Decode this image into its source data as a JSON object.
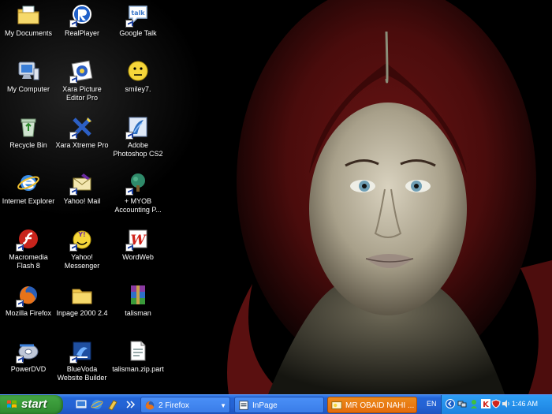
{
  "desktop": {
    "icons": [
      {
        "label": "My Documents",
        "icon": "folder-docs-icon"
      },
      {
        "label": "RealPlayer",
        "icon": "realplayer-icon"
      },
      {
        "label": "Google Talk",
        "icon": "google-talk-icon"
      },
      {
        "label": "My Computer",
        "icon": "computer-icon"
      },
      {
        "label": "Xara Picture Editor Pro",
        "icon": "xara-picture-icon"
      },
      {
        "label": "smiley7.",
        "icon": "smiley-icon"
      },
      {
        "label": "Recycle Bin",
        "icon": "recycle-bin-icon"
      },
      {
        "label": "Xara Xtreme Pro",
        "icon": "xara-xtreme-icon"
      },
      {
        "label": "Adobe Photoshop CS2",
        "icon": "photoshop-icon"
      },
      {
        "label": "Internet Explorer",
        "icon": "internet-explorer-icon"
      },
      {
        "label": "Yahoo! Mail",
        "icon": "yahoo-mail-icon"
      },
      {
        "label": "+ MYOB Accounting P...",
        "icon": "myob-icon"
      },
      {
        "label": "Macromedia Flash 8",
        "icon": "flash-icon"
      },
      {
        "label": "Yahoo! Messenger",
        "icon": "yahoo-messenger-icon"
      },
      {
        "label": "WordWeb",
        "icon": "wordweb-icon"
      },
      {
        "label": "Mozilla Firefox",
        "icon": "firefox-icon"
      },
      {
        "label": "Inpage 2000 2.4",
        "icon": "folder-icon"
      },
      {
        "label": "talisman",
        "icon": "winrar-icon"
      },
      {
        "label": "PowerDVD",
        "icon": "powerdvd-icon"
      },
      {
        "label": "BlueVoda Website Builder",
        "icon": "bluevoda-icon"
      },
      {
        "label": "talisman.zip.part",
        "icon": "file-icon"
      }
    ]
  },
  "taskbar": {
    "start_label": "start",
    "tasks": [
      {
        "label": "2 Firefox",
        "icon": "firefox-icon"
      },
      {
        "label": "InPage",
        "icon": "inpage-icon"
      },
      {
        "label": "MR OBAID NAHI ...",
        "icon": "messenger-window-icon"
      }
    ],
    "language": "EN",
    "clock": "1:46 AM"
  },
  "colors": {
    "taskbar_blue": "#2466d9",
    "start_green": "#3b9c3b",
    "active_task_orange": "#e46c0a",
    "tray_blue": "#1d83e0"
  }
}
